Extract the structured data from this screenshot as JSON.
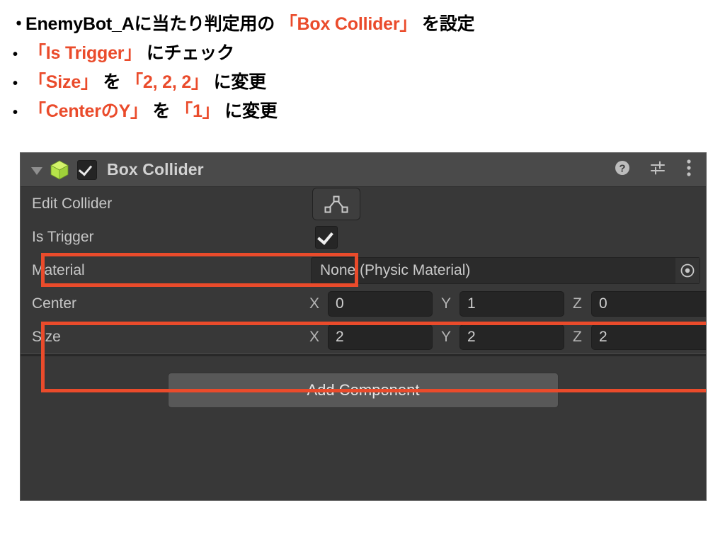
{
  "instructions": {
    "lines": [
      {
        "marker": "・",
        "marker_style": "kanten",
        "segments": [
          {
            "text": "EnemyBot_Aに当たり判定用の ",
            "color": "black"
          },
          {
            "text": "「Box Collider」",
            "color": "red"
          },
          {
            "text": " を設定",
            "color": "black"
          }
        ]
      },
      {
        "marker": "•",
        "marker_style": "dot",
        "segments": [
          {
            "text": "「Is Trigger」",
            "color": "red"
          },
          {
            "text": " にチェック",
            "color": "black"
          }
        ]
      },
      {
        "marker": "•",
        "marker_style": "dot",
        "segments": [
          {
            "text": "「Size」",
            "color": "red"
          },
          {
            "text": " を ",
            "color": "black"
          },
          {
            "text": "「2, 2, 2」",
            "color": "red"
          },
          {
            "text": " に変更",
            "color": "black"
          }
        ]
      },
      {
        "marker": "•",
        "marker_style": "dot",
        "segments": [
          {
            "text": "「CenterのY」",
            "color": "red"
          },
          {
            "text": " を ",
            "color": "black"
          },
          {
            "text": "「1」",
            "color": "red"
          },
          {
            "text": " に変更",
            "color": "black"
          }
        ]
      }
    ]
  },
  "inspector": {
    "component": {
      "title": "Box Collider",
      "foldout_icon": "triangle-down-icon",
      "type_icon": "box-collider-cube-icon",
      "enabled": true,
      "enabled_checkmark": "checkmark-icon",
      "header_icons": [
        {
          "name": "help-icon",
          "glyph": "?"
        },
        {
          "name": "preset-icon",
          "glyph": "sliders"
        },
        {
          "name": "more-menu-icon",
          "glyph": "kebab"
        }
      ]
    },
    "rows": {
      "edit_collider": {
        "label": "Edit Collider",
        "button_icon": "collider-edit-polygon-icon"
      },
      "is_trigger": {
        "label": "Is Trigger",
        "value": true,
        "checkmark": "checkmark-icon"
      },
      "material": {
        "label": "Material",
        "value": "None (Physic Material)",
        "picker_icon": "object-picker-icon"
      },
      "center": {
        "label": "Center",
        "axes": [
          {
            "axis": "X",
            "value": "0"
          },
          {
            "axis": "Y",
            "value": "1"
          },
          {
            "axis": "Z",
            "value": "0"
          }
        ]
      },
      "size": {
        "label": "Size",
        "axes": [
          {
            "axis": "X",
            "value": "2"
          },
          {
            "axis": "Y",
            "value": "2"
          },
          {
            "axis": "Z",
            "value": "2"
          }
        ]
      }
    },
    "add_component": {
      "label": "Add Component"
    }
  },
  "colors": {
    "highlight_red": "#ea4b2b",
    "panel_background": "#383838",
    "header_background": "#4a4a4a",
    "cube_icon_green": "#b6e34a",
    "field_background": "#252525",
    "add_component_background": "#585858",
    "text_primary": "#c9c9c9"
  },
  "annotations": {
    "boxes": [
      {
        "name": "is-trigger-highlight",
        "target": "is_trigger"
      },
      {
        "name": "center-size-highlight",
        "target": "center_and_size"
      }
    ]
  }
}
